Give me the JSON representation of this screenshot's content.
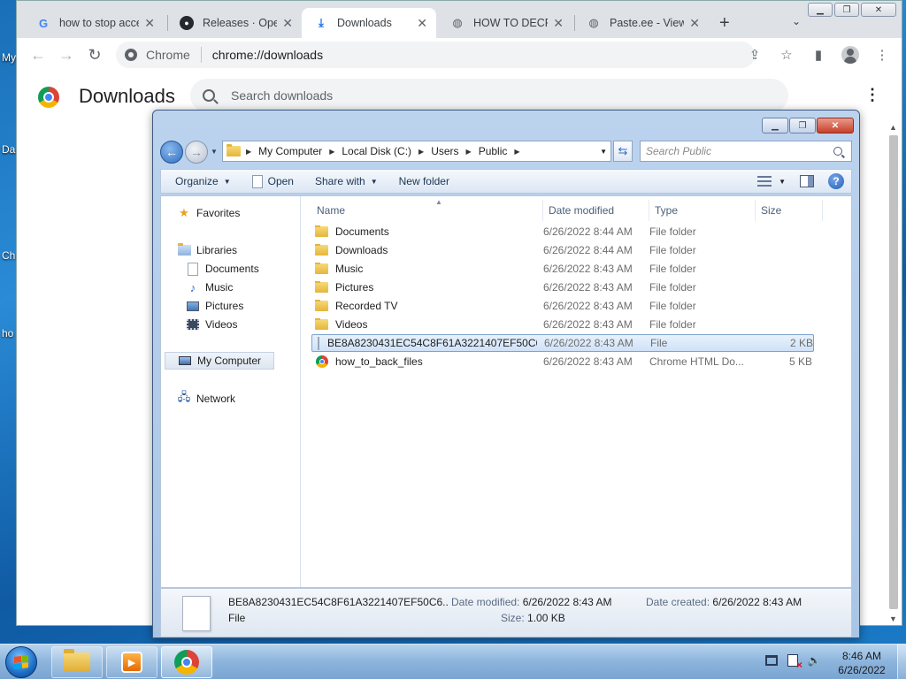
{
  "desktop": {
    "labels": [
      "My",
      "Da",
      "Ch",
      "ho"
    ]
  },
  "chrome": {
    "tabs": [
      {
        "title": "how to stop acce",
        "icon": "google-icon"
      },
      {
        "title": "Releases · Open",
        "icon": "github-icon"
      },
      {
        "title": "Downloads",
        "icon": "download-icon",
        "active": true
      },
      {
        "title": "HOW TO DECRY",
        "icon": "globe-icon"
      },
      {
        "title": "Paste.ee - View p",
        "icon": "globe-icon"
      }
    ],
    "omnibox": {
      "site": "Chrome",
      "url": "chrome://downloads"
    },
    "page": {
      "title": "Downloads",
      "search_placeholder": "Search downloads"
    }
  },
  "explorer": {
    "breadcrumb": [
      "My Computer",
      "Local Disk (C:)",
      "Users",
      "Public"
    ],
    "search_placeholder": "Search Public",
    "commands": {
      "organize": "Organize",
      "open": "Open",
      "share": "Share with",
      "new_folder": "New folder"
    },
    "nav": {
      "favorites": "Favorites",
      "libraries": "Libraries",
      "library_items": [
        "Documents",
        "Music",
        "Pictures",
        "Videos"
      ],
      "computer": "My Computer",
      "network": "Network"
    },
    "columns": {
      "name": "Name",
      "date": "Date modified",
      "type": "Type",
      "size": "Size"
    },
    "files": [
      {
        "name": "Documents",
        "date": "6/26/2022 8:44 AM",
        "type": "File folder",
        "size": "",
        "kind": "folder"
      },
      {
        "name": "Downloads",
        "date": "6/26/2022 8:44 AM",
        "type": "File folder",
        "size": "",
        "kind": "folder"
      },
      {
        "name": "Music",
        "date": "6/26/2022 8:43 AM",
        "type": "File folder",
        "size": "",
        "kind": "folder"
      },
      {
        "name": "Pictures",
        "date": "6/26/2022 8:43 AM",
        "type": "File folder",
        "size": "",
        "kind": "folder"
      },
      {
        "name": "Recorded TV",
        "date": "6/26/2022 8:43 AM",
        "type": "File folder",
        "size": "",
        "kind": "folder"
      },
      {
        "name": "Videos",
        "date": "6/26/2022 8:43 AM",
        "type": "File folder",
        "size": "",
        "kind": "folder"
      },
      {
        "name": "BE8A8230431EC54C8F61A3221407EF50C6...",
        "date": "6/26/2022 8:43 AM",
        "type": "File",
        "size": "2 KB",
        "kind": "file",
        "selected": true
      },
      {
        "name": "how_to_back_files",
        "date": "6/26/2022 8:43 AM",
        "type": "Chrome HTML Do...",
        "size": "5 KB",
        "kind": "chrome"
      }
    ],
    "details": {
      "name": "BE8A8230431EC54C8F61A3221407EF50C6...",
      "type": "File",
      "modified_label": "Date modified:",
      "modified": "6/26/2022 8:43 AM",
      "created_label": "Date created:",
      "created": "6/26/2022 8:43 AM",
      "size_label": "Size:",
      "size": "1.00 KB"
    }
  },
  "taskbar": {
    "time": "8:46 AM",
    "date": "6/26/2022"
  }
}
